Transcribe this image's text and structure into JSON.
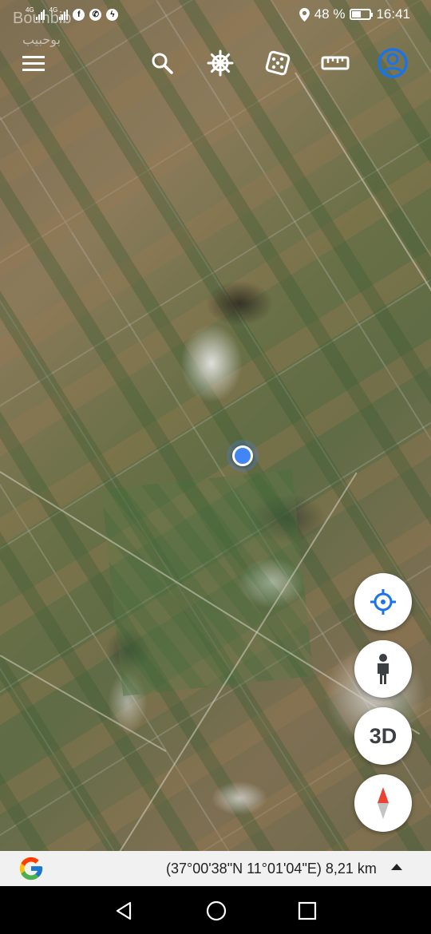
{
  "status_bar": {
    "network_1": "4G",
    "network_2": "4G",
    "battery_percent": "48 %",
    "battery_level": 0.48,
    "time": "16:41"
  },
  "map": {
    "place_label": "Bouhbib",
    "place_label_ar": "بوحبيب"
  },
  "toolbar": {
    "menu_icon": "hamburger-menu-icon",
    "search_icon": "search-icon",
    "voyager_icon": "ship-wheel-icon",
    "feeling_lucky_icon": "dice-icon",
    "measure_icon": "ruler-icon",
    "account_icon": "account-icon",
    "account_color": "#1a73e8"
  },
  "controls": {
    "location_icon": "crosshair-location-icon",
    "street_view_icon": "pegman-icon",
    "three_d_label": "3D",
    "compass_icon": "compass-icon"
  },
  "info_bar": {
    "coordinates": "(37°00'38\"N 11°01'04\"E) 8,21 km"
  },
  "colors": {
    "location_dot": "#4285f4",
    "control_icon": "#1a73e8",
    "compass_north": "#ea4335"
  }
}
